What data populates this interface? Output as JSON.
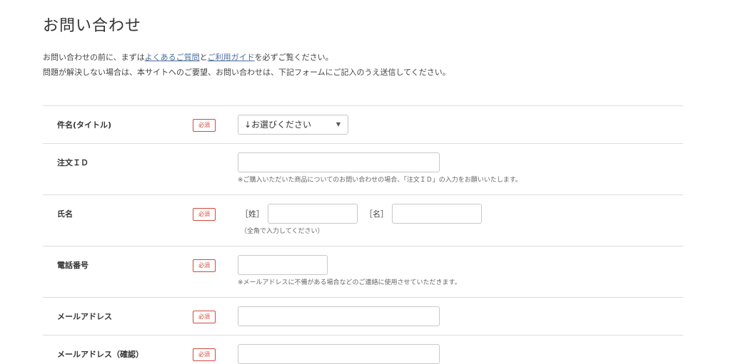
{
  "page_title": "お問い合わせ",
  "intro": {
    "line1_before": "お問い合わせの前に、まずは",
    "faq_link": "よくあるご質問",
    "line1_mid": "と",
    "guide_link": "ご利用ガイド",
    "line1_after": "を必ずご覧ください。",
    "line2": "問題が解決しない場合は、本サイトへのご要望、お問い合わせは、下記フォームにご記入のうえ送信してください。"
  },
  "required_label": "必須",
  "form": {
    "subject": {
      "label": "件名(タイトル)",
      "select_value": "↓お選びください",
      "arrow": "▼"
    },
    "order_id": {
      "label": "注文ＩＤ",
      "note": "※ご購入いただいた商品についてのお問い合わせの場合、「注文ＩＤ」の入力をお願いいたします。"
    },
    "name": {
      "label": "氏名",
      "last_bracket": "［姓］",
      "first_bracket": "［名］",
      "note": "（全角で入力してください）"
    },
    "phone": {
      "label": "電話番号",
      "note": "※メールアドレスに不備がある場合などのご連絡に使用させていただきます。"
    },
    "email": {
      "label": "メールアドレス"
    },
    "email_confirm": {
      "label": "メールアドレス（確認）"
    }
  }
}
